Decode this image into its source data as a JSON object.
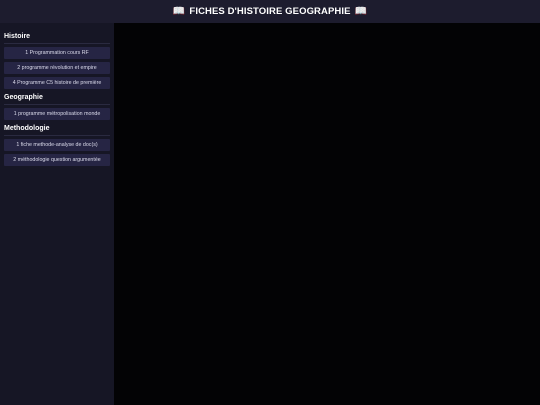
{
  "header": {
    "icon": "open-book-icon",
    "title": "FICHES D'HISTOIRE GEOGRAPHIE"
  },
  "sidebar": {
    "sections": [
      {
        "title": "Histoire",
        "items": [
          "1 Programmation cours RF",
          "2 programme révolution et empire",
          "4 Programme C5 histoire de première"
        ]
      },
      {
        "title": "Geographie",
        "items": [
          "1 programme métropolisation monde"
        ]
      },
      {
        "title": "Methodologie",
        "items": [
          "1 fiche methode-analyse de doc(s)",
          "2 méthodologie question argumentée"
        ]
      }
    ]
  },
  "colors": {
    "header_bg": "#1d1c2e",
    "sidebar_bg": "#161625",
    "nav_item_bg": "#262544",
    "main_bg": "#030305"
  }
}
